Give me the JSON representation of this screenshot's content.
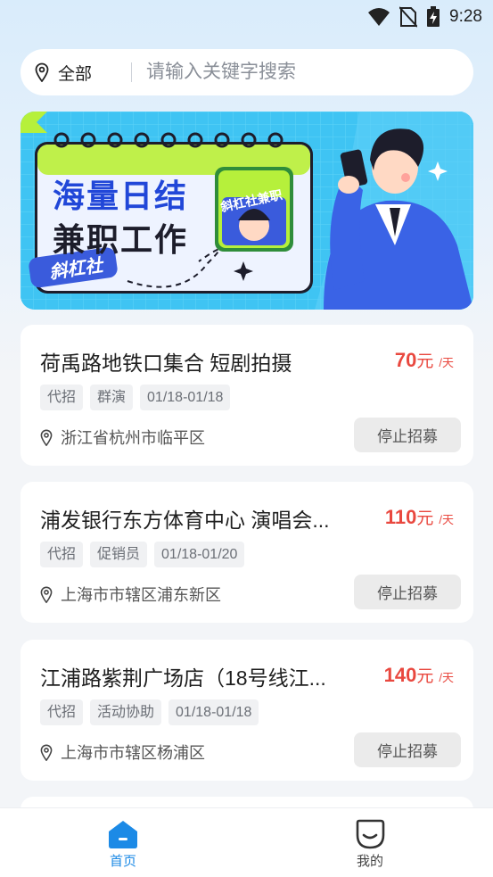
{
  "status_bar": {
    "time": "9:28"
  },
  "search": {
    "location_label": "全部",
    "placeholder": "请输入关键字搜索"
  },
  "banner": {
    "line1": "海量日结",
    "line2": "兼职工作",
    "brand_tag": "斜杠社",
    "badge": "斜杠社兼职"
  },
  "cards": [
    {
      "title": "荷禹路地铁口集合 短剧拍摄",
      "price": "70",
      "currency": "元",
      "per": "/天",
      "tags": [
        "代招",
        "群演",
        "01/18-01/18"
      ],
      "location": "浙江省杭州市临平区",
      "action": "停止招募"
    },
    {
      "title": "浦发银行东方体育中心 演唱会...",
      "price": "110",
      "currency": "元",
      "per": "/天",
      "tags": [
        "代招",
        "促销员",
        "01/18-01/20"
      ],
      "location": "上海市市辖区浦东新区",
      "action": "停止招募"
    },
    {
      "title": "江浦路紫荆广场店（18号线江...",
      "price": "140",
      "currency": "元",
      "per": "/天",
      "tags": [
        "代招",
        "活动协助",
        "01/18-01/18"
      ],
      "location": "上海市市辖区杨浦区",
      "action": "停止招募"
    }
  ],
  "tabs": [
    {
      "label": "首页",
      "icon": "home-icon",
      "active": true
    },
    {
      "label": "我的",
      "icon": "profile-icon",
      "active": false
    }
  ],
  "colors": {
    "accent": "#1c8ae6",
    "price": "#e9483f",
    "banner_bg": "#40c7f5"
  }
}
